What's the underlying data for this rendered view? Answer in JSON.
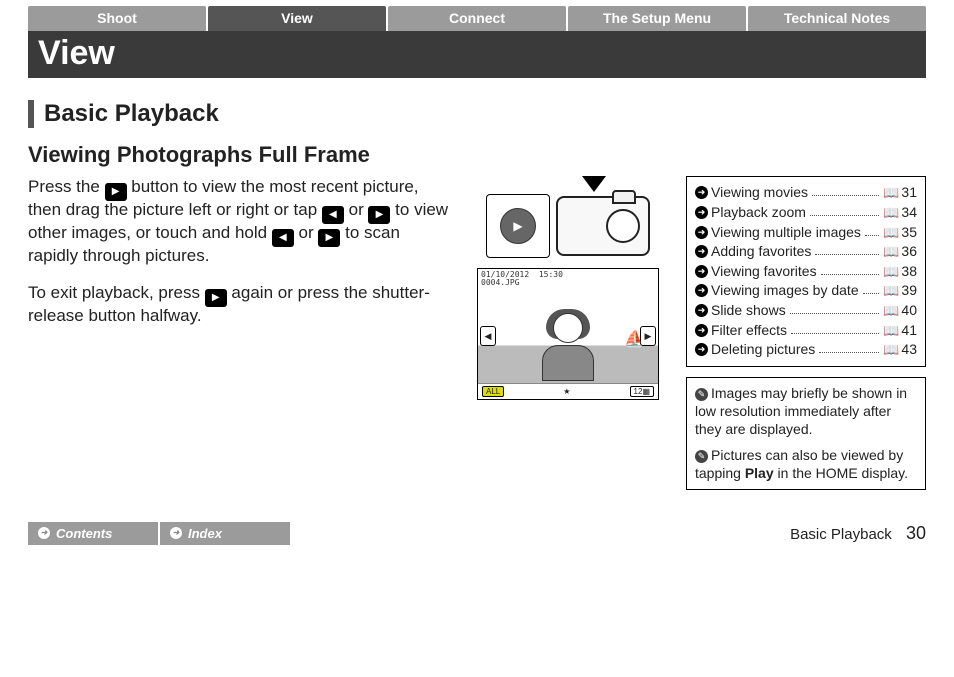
{
  "tabs": [
    "Shoot",
    "View",
    "Connect",
    "The Setup Menu",
    "Technical Notes"
  ],
  "active_tab_index": 1,
  "chapter_title": "View",
  "section_title": "Basic Playback",
  "subsection_title": "Viewing Photographs Full Frame",
  "body": {
    "p1_a": "Press the ",
    "p1_b": " button to view the most recent picture, then drag the picture left or right or tap ",
    "p1_c": " or ",
    "p1_d": " to view other images, or touch and hold ",
    "p1_e": " or ",
    "p1_f": " to scan rapidly through pictures.",
    "p2_a": "To exit playback, press ",
    "p2_b": " again or press the shutter-release button halfway."
  },
  "screen": {
    "date": "01/10/2012",
    "time": "15:30",
    "file": "0004.JPG",
    "btn_all": "ALL",
    "btn_count": "12"
  },
  "xrefs": [
    {
      "label": "Viewing movies",
      "page": 31
    },
    {
      "label": "Playback zoom",
      "page": 34
    },
    {
      "label": "Viewing multiple images",
      "page": 35
    },
    {
      "label": "Adding favorites",
      "page": 36
    },
    {
      "label": "Viewing favorites",
      "page": 38
    },
    {
      "label": "Viewing images by date",
      "page": 39
    },
    {
      "label": "Slide shows",
      "page": 40
    },
    {
      "label": "Filter effects",
      "page": 41
    },
    {
      "label": "Deleting pictures",
      "page": 43
    }
  ],
  "notes": {
    "n1": "Images may briefly be shown in low resolution immediately after they are displayed.",
    "n2_a": "Pictures can also be viewed by tapping ",
    "n2_bold": "Play",
    "n2_b": " in the HOME display."
  },
  "footer": {
    "links": [
      "Contents",
      "Index"
    ],
    "section": "Basic Playback",
    "page": 30
  }
}
